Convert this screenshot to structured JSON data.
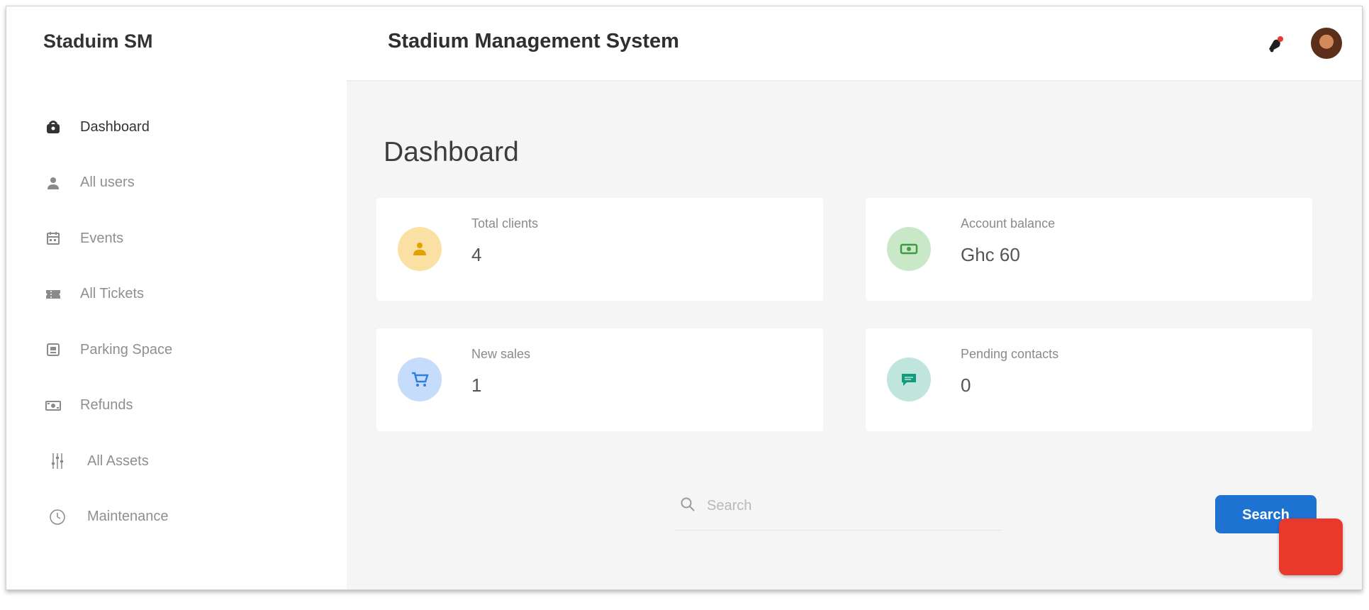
{
  "sidebar": {
    "brand": "Staduim SM",
    "items": [
      {
        "label": "Dashboard",
        "icon": "dashboard-icon"
      },
      {
        "label": "All users",
        "icon": "user-icon"
      },
      {
        "label": "Events",
        "icon": "calendar-icon"
      },
      {
        "label": "All Tickets",
        "icon": "ticket-icon"
      },
      {
        "label": "Parking Space",
        "icon": "parking-icon"
      },
      {
        "label": "Refunds",
        "icon": "refund-icon"
      },
      {
        "label": "All Assets",
        "icon": "sliders-icon"
      },
      {
        "label": "Maintenance",
        "icon": "clock-icon"
      }
    ]
  },
  "header": {
    "title": "Stadium Management System",
    "notification_icon": "notification-icon",
    "avatar": "user-avatar"
  },
  "main": {
    "title": "Dashboard",
    "cards": [
      {
        "label": "Total clients",
        "value": "4",
        "icon": "clients-icon",
        "bg": "#fbe0a3",
        "fg": "#e2a100"
      },
      {
        "label": "Account balance",
        "value": "Ghc 60",
        "icon": "money-icon",
        "bg": "#c9e8c8",
        "fg": "#3f9a44"
      },
      {
        "label": "New sales",
        "value": "1",
        "icon": "cart-icon",
        "bg": "#c6dcfb",
        "fg": "#2f7fe2"
      },
      {
        "label": "Pending contacts",
        "value": "0",
        "icon": "chat-icon",
        "bg": "#bfe5dc",
        "fg": "#149a7c"
      }
    ],
    "search": {
      "placeholder": "Search",
      "value": ""
    },
    "search_button": "Search",
    "accent": "#1e73d2",
    "fab_color": "#e8392c"
  }
}
